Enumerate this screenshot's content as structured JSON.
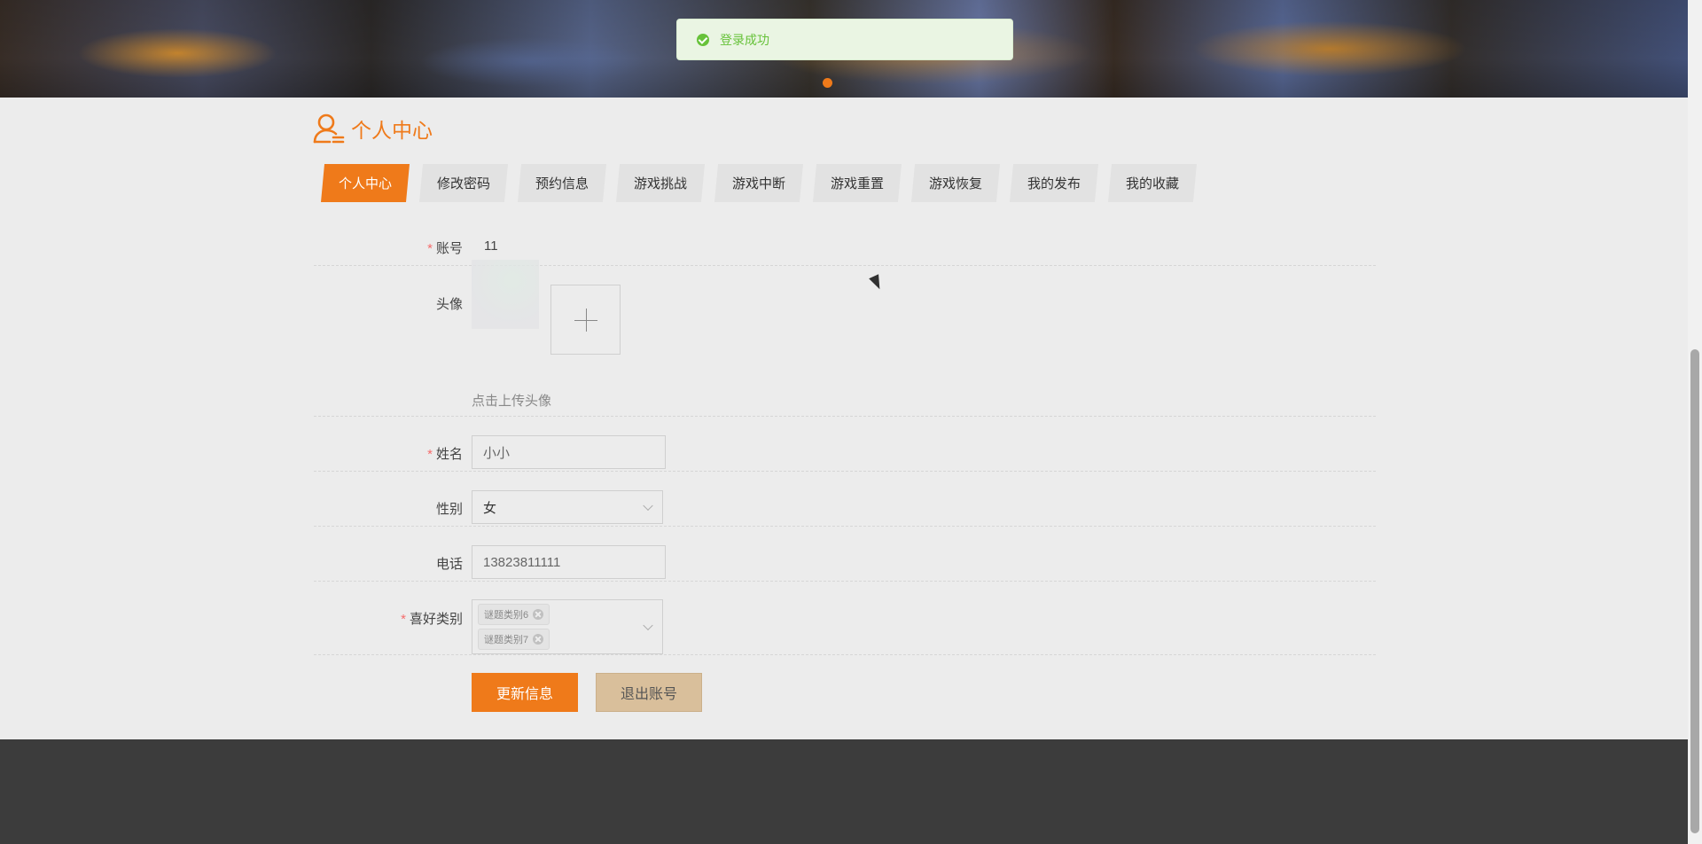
{
  "banner": {
    "active_dot": 1
  },
  "toast": {
    "message": "登录成功",
    "icon": "check-circle-icon",
    "color": "#67c23a"
  },
  "page": {
    "title": "个人中心",
    "title_icon": "user-center-icon",
    "accent": "#ef7a1a"
  },
  "tabs": [
    {
      "label": "个人中心",
      "active": true
    },
    {
      "label": "修改密码"
    },
    {
      "label": "预约信息"
    },
    {
      "label": "游戏挑战"
    },
    {
      "label": "游戏中断"
    },
    {
      "label": "游戏重置"
    },
    {
      "label": "游戏恢复"
    },
    {
      "label": "我的发布"
    },
    {
      "label": "我的收藏"
    }
  ],
  "form": {
    "account": {
      "label": "账号",
      "value": "11",
      "required": true
    },
    "avatar": {
      "label": "头像",
      "hint": "点击上传头像",
      "upload_icon": "plus-icon"
    },
    "name": {
      "label": "姓名",
      "value": "小小",
      "required": true
    },
    "gender": {
      "label": "性别",
      "value": "女"
    },
    "phone": {
      "label": "电话",
      "value": "13823811111"
    },
    "preference": {
      "label": "喜好类别",
      "required": true,
      "tags": [
        "谜题类别6",
        "谜题类别7"
      ]
    }
  },
  "actions": {
    "update_label": "更新信息",
    "logout_label": "退出账号"
  }
}
